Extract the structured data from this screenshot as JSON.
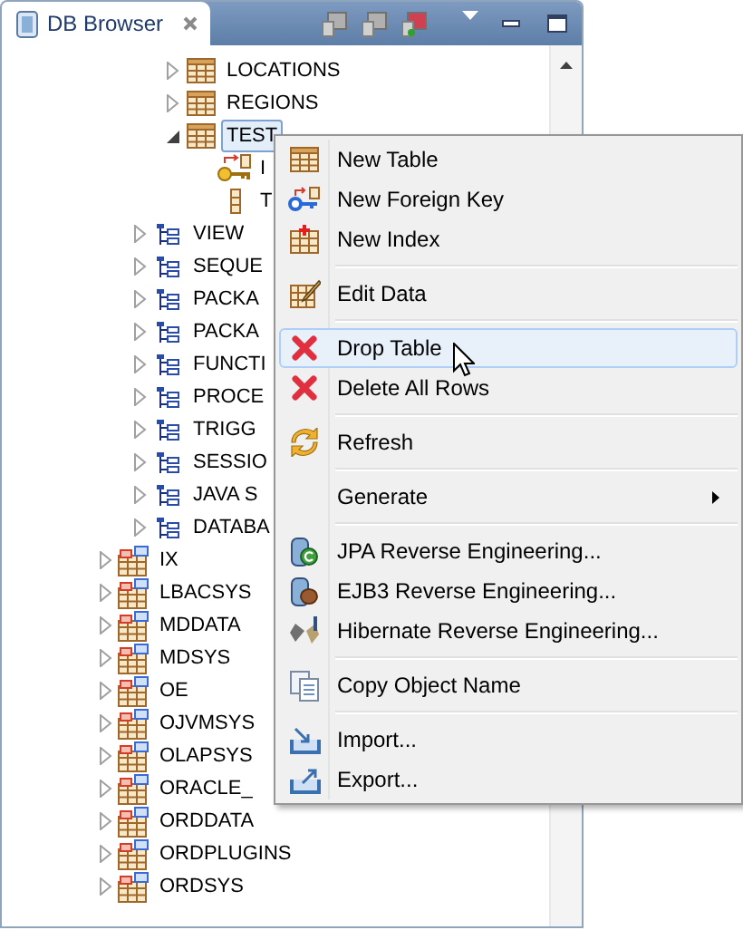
{
  "panel": {
    "tab": {
      "title": "DB Browser"
    }
  },
  "tree": [
    {
      "children": [
        {
          "children": [
            {
              "label": "LOCATIONS",
              "kind": "table",
              "expanded": false,
              "selected": false
            },
            {
              "label": "REGIONS",
              "kind": "table",
              "expanded": false,
              "selected": false
            },
            {
              "label": "TEST",
              "kind": "table",
              "expanded": true,
              "selected": true,
              "children": [
                {
                  "label": "I",
                  "kind": "key",
                  "selected": false
                },
                {
                  "label": "T",
                  "kind": "column",
                  "selected": false
                }
              ]
            }
          ]
        },
        {
          "label": "VIEW",
          "kind": "folder",
          "expanded": false,
          "selected": false
        },
        {
          "label": "SEQUE",
          "kind": "folder",
          "expanded": false,
          "selected": false
        },
        {
          "label": "PACKA",
          "kind": "folder",
          "expanded": false,
          "selected": false
        },
        {
          "label": "PACKA",
          "kind": "folder",
          "expanded": false,
          "selected": false
        },
        {
          "label": "FUNCTI",
          "kind": "folder",
          "expanded": false,
          "selected": false
        },
        {
          "label": "PROCE",
          "kind": "folder",
          "expanded": false,
          "selected": false
        },
        {
          "label": "TRIGG",
          "kind": "folder",
          "expanded": false,
          "selected": false
        },
        {
          "label": "SESSIO",
          "kind": "folder",
          "expanded": false,
          "selected": false
        },
        {
          "label": "JAVA S",
          "kind": "folder",
          "expanded": false,
          "selected": false
        },
        {
          "label": "DATABA",
          "kind": "folder",
          "expanded": false,
          "selected": false
        }
      ]
    },
    {
      "label": "IX",
      "kind": "schema",
      "expanded": false,
      "selected": false
    },
    {
      "label": "LBACSYS",
      "kind": "schema",
      "expanded": false,
      "selected": false
    },
    {
      "label": "MDDATA",
      "kind": "schema",
      "expanded": false,
      "selected": false
    },
    {
      "label": "MDSYS",
      "kind": "schema",
      "expanded": false,
      "selected": false
    },
    {
      "label": "OE",
      "kind": "schema",
      "expanded": false,
      "selected": false
    },
    {
      "label": "OJVMSYS",
      "kind": "schema",
      "expanded": false,
      "selected": false
    },
    {
      "label": "OLAPSYS",
      "kind": "schema",
      "expanded": false,
      "selected": false
    },
    {
      "label": "ORACLE_",
      "kind": "schema",
      "expanded": false,
      "selected": false
    },
    {
      "label": "ORDDATA",
      "kind": "schema",
      "expanded": false,
      "selected": false
    },
    {
      "label": "ORDPLUGINS",
      "kind": "schema",
      "expanded": false,
      "selected": false
    },
    {
      "label": "ORDSYS",
      "kind": "schema",
      "expanded": false,
      "selected": false
    }
  ],
  "context_menu": [
    {
      "kind": "item",
      "label": "New Table",
      "selected": false
    },
    {
      "kind": "item",
      "label": "New Foreign Key",
      "selected": false
    },
    {
      "kind": "item",
      "label": "New Index",
      "selected": false
    },
    {
      "kind": "separator"
    },
    {
      "kind": "item",
      "label": "Edit Data",
      "selected": false
    },
    {
      "kind": "separator"
    },
    {
      "kind": "item",
      "label": "Drop Table",
      "selected": true
    },
    {
      "kind": "item",
      "label": "Delete All Rows",
      "selected": false
    },
    {
      "kind": "separator"
    },
    {
      "kind": "item",
      "label": "Refresh",
      "selected": false
    },
    {
      "kind": "separator"
    },
    {
      "kind": "submenu",
      "label": "Generate",
      "selected": false
    },
    {
      "kind": "separator"
    },
    {
      "kind": "item",
      "label": "JPA Reverse Engineering...",
      "selected": false
    },
    {
      "kind": "item",
      "label": "EJB3 Reverse Engineering...",
      "selected": false
    },
    {
      "kind": "item",
      "label": "Hibernate Reverse Engineering...",
      "selected": false
    },
    {
      "kind": "separator"
    },
    {
      "kind": "item",
      "label": "Copy Object Name",
      "selected": false
    },
    {
      "kind": "separator"
    },
    {
      "kind": "item",
      "label": "Import...",
      "selected": false
    },
    {
      "kind": "item",
      "label": "Export...",
      "selected": false
    }
  ]
}
